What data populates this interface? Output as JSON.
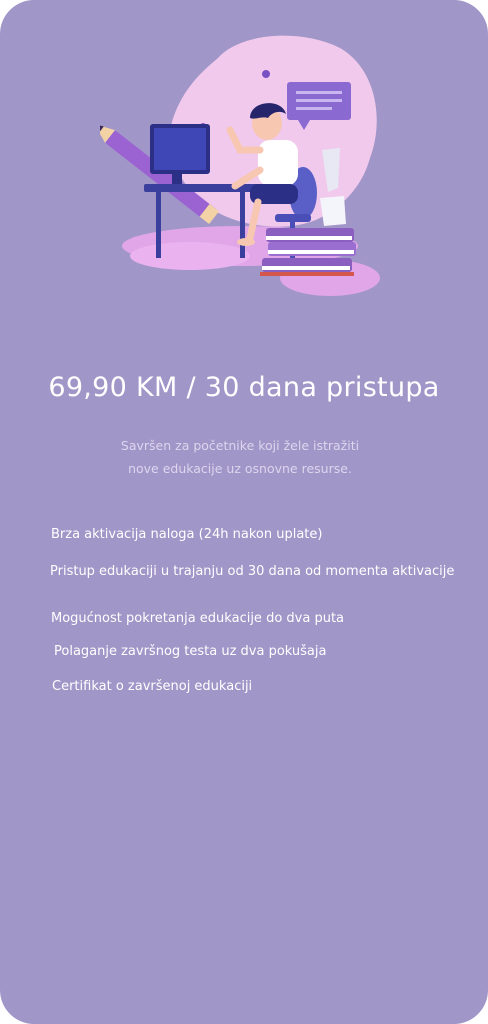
{
  "plan": {
    "price": "69,90 KM / 30 dana pristupa",
    "description_line1": "Savršen za početnike koji žele istražiti",
    "description_line2": "nove edukacije uz osnovne resurse.",
    "features": [
      "Brza aktivacija naloga (24h nakon uplate)",
      "Pristup edukaciji u trajanju od 30 dana od momenta aktivacije",
      "Mogućnost pokretanja edukacije do dva puta",
      "Polaganje završnog testa uz dva pokušaja",
      "Certifikat o završenoj edukaciji"
    ]
  },
  "illustration": {
    "icon": "student-at-computer-illustration"
  },
  "colors": {
    "card_background": "#a196c8",
    "text_primary": "#ffffff",
    "text_secondary": "#dcd6ee",
    "blob_pink": "#f1c9ec",
    "desk_blue": "#3a3f9e",
    "book_purple": "#8b5fbf"
  }
}
